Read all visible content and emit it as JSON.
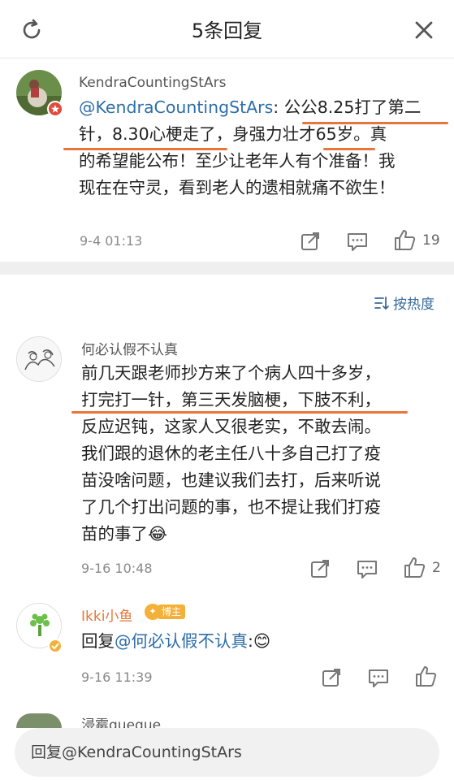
{
  "header": {
    "title": "5条回复"
  },
  "comment1": {
    "username": "KendraCountingStArs",
    "mention": "@KendraCountingStArs",
    "lines": [
      "公公8.25打了第二",
      "针，8.30心梗走了，身强力壮才65岁。真",
      "的希望能公布！至少让老年人有个准备！我",
      "现在在守灵，看到老人的遗相就痛不欲生！"
    ],
    "time": "9-4 01:13",
    "likes": "19"
  },
  "sort": {
    "label": "按热度"
  },
  "comment2": {
    "username": "何必认假不认真",
    "lines": [
      "前几天跟老师抄方来了个病人四十多岁，",
      "打完打一针，第三天发脑梗，下肢不利，",
      "反应迟钝，这家人又很老实，不敢去闹。",
      "我们跟的退休的老主任八十多自己打了疫",
      "苗没啥问题，也建议我们去打，后来听说",
      "了几个打出问题的事，也不提让我们打疫",
      "苗的事了😂"
    ],
    "time": "9-16 10:48",
    "likes": "2"
  },
  "comment3": {
    "username": "Ikki小鱼",
    "badge": "博主",
    "reply_prefix": "回复",
    "reply_mention": "@何必认假不认真",
    "reply_suffix": ":😊",
    "time": "9-16 11:39"
  },
  "comment4": {
    "username_partial": "浸霉queque"
  },
  "reply_box": {
    "placeholder": "回复@KendraCountingStArs"
  },
  "icons": {
    "refresh": "refresh-icon",
    "close": "close-icon",
    "share": "share-icon",
    "comment": "comment-icon",
    "like": "thumbs-up-icon",
    "sort": "sort-icon"
  },
  "colors": {
    "highlight": "#e8753a",
    "mention": "#2d6ea8",
    "verified": "#f4b13a"
  }
}
